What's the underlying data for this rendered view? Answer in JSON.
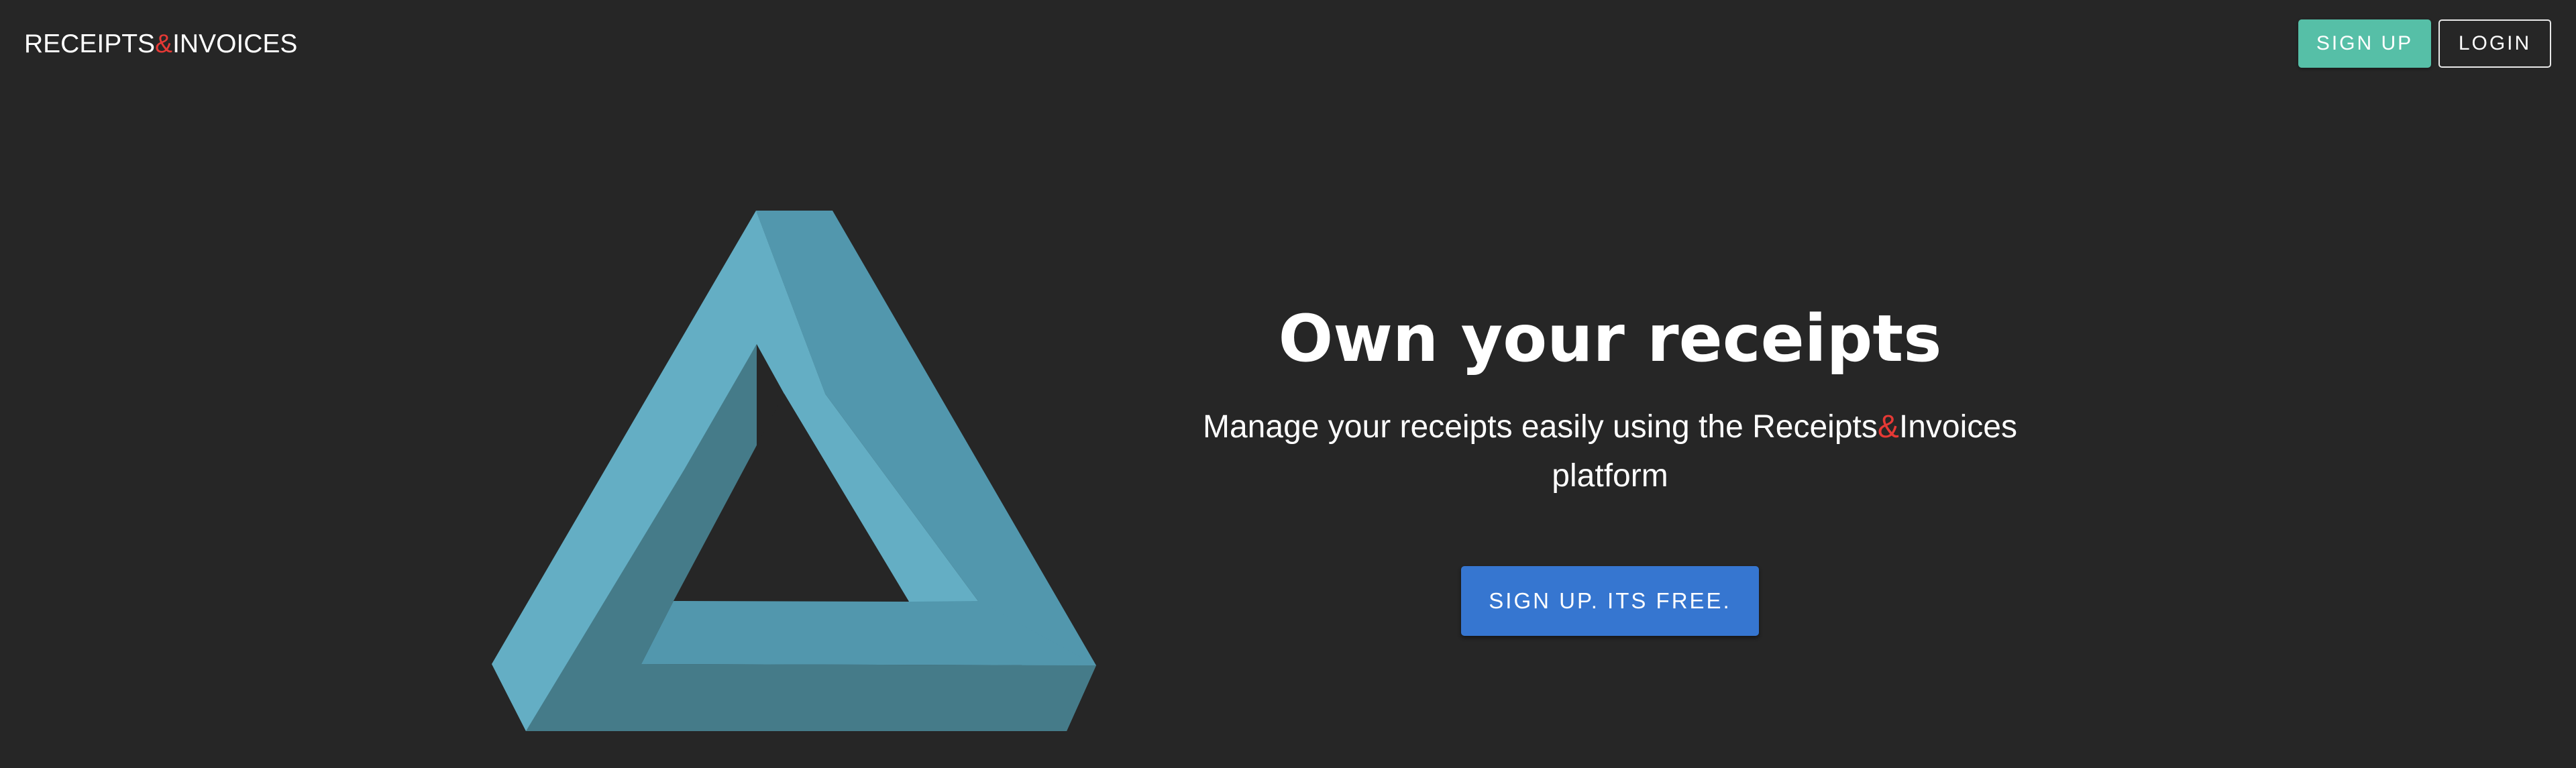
{
  "header": {
    "logo": {
      "part1": "RECEIPTS",
      "amp": "&",
      "part2": "INVOICES"
    },
    "signup_label": "SIGN UP",
    "login_label": "LOGIN"
  },
  "hero": {
    "headline": "Own your receipts",
    "subtitle": {
      "before": "Manage your receipts easily using the Receipts",
      "amp": "&",
      "after": "Invoices platform"
    },
    "cta_label": "SIGN UP. ITS FREE.",
    "illustration_icon": "impossible-triangle-icon"
  },
  "colors": {
    "background": "#262626",
    "accent_red": "#e53935",
    "signup_green": "#56bfa7",
    "cta_blue": "#3676d0",
    "triangle_light": "#64aec4",
    "triangle_mid": "#5297ad",
    "triangle_dark": "#457b89"
  }
}
